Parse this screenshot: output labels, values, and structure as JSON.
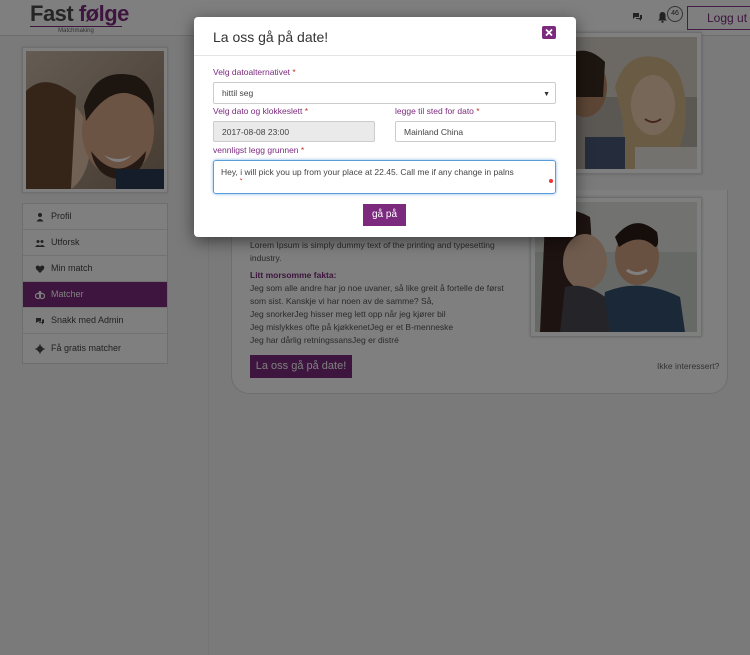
{
  "header": {
    "logo_part1": "Fast ",
    "logo_part2": "følge",
    "logo_sub": "Matchmaking",
    "notifications_count": "46",
    "logout_label": "Logg ut"
  },
  "sidebar": {
    "items": [
      {
        "label": "Profil",
        "icon": "user-icon"
      },
      {
        "label": "Utforsk",
        "icon": "users-icon"
      },
      {
        "label": "Min match",
        "icon": "heart-icon"
      },
      {
        "label": "Matcher",
        "icon": "match-icon",
        "active": true
      },
      {
        "label": "Snakk med Admin",
        "icon": "chat-icon"
      },
      {
        "label": "Få gratis matcher",
        "icon": "gear-icon"
      }
    ]
  },
  "profile": {
    "about": "Lorem Ipsum is simply dummy text of the printing and typesetting industry.",
    "fun_facts_title": "Litt morsomme fakta:",
    "fun_facts": [
      "Jeg som alle andre har jo noe uvaner, så like greit å fortelle de først",
      "som sist. Kanskje vi har noen av de samme? Så,",
      "Jeg snorkerJeg hisser meg lett opp når jeg kjører bil",
      "Jeg mislykkes ofte på kjøkkenetJeg er et B-menneske",
      "Jeg har dårlig retningssansJeg er distré"
    ],
    "date_button": "La oss gå på date!",
    "not_interested": "Ikke interessert?"
  },
  "modal": {
    "title": "La oss gå på date!",
    "date_option_label": "Velg datoalternativet",
    "date_option_value": "hittil seg",
    "datetime_label": "Velg dato og klokkeslett",
    "datetime_value": "2017-08-08 23:00",
    "place_label": "legge til sted for dato",
    "place_value": "Mainland China",
    "reason_label": "vennligst legg grunnen",
    "reason_start": "Hey,",
    "reason_misspelled": "i",
    "reason_rest": "will pick you up from your place at 22.45. Call me if any change in palns",
    "required_mark": "*",
    "submit_label": "gå på"
  },
  "colors": {
    "accent": "#7b2a7e",
    "overlay": "rgba(0,0,0,0.5)"
  }
}
